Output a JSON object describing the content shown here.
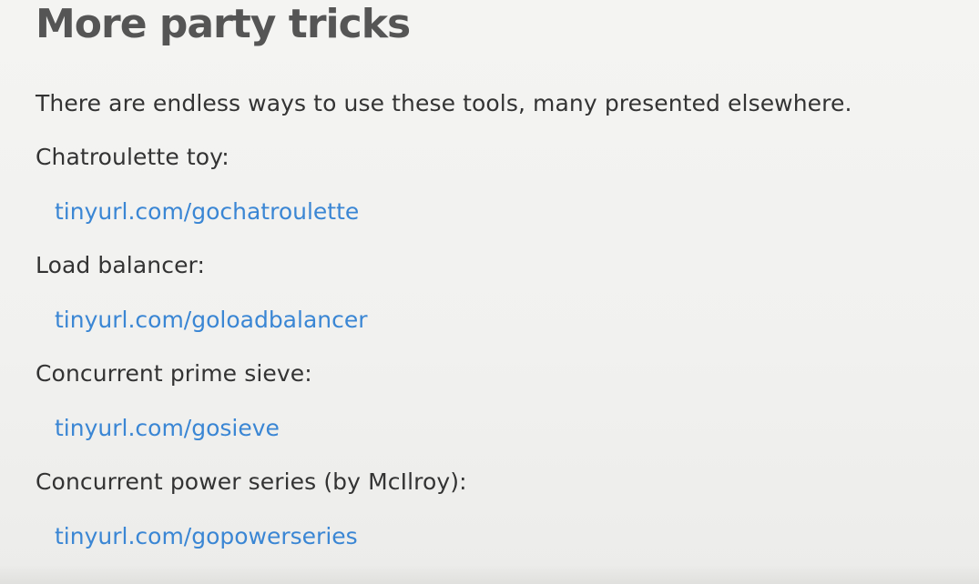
{
  "slide": {
    "title": "More party tricks",
    "intro": "There are endless ways to use these tools, many presented elsewhere.",
    "items": [
      {
        "label": "Chatroulette toy:",
        "link": "tinyurl.com/gochatroulette"
      },
      {
        "label": "Load balancer:",
        "link": "tinyurl.com/goloadbalancer"
      },
      {
        "label": "Concurrent prime sieve:",
        "link": "tinyurl.com/gosieve"
      },
      {
        "label": "Concurrent power series (by McIlroy):",
        "link": "tinyurl.com/gopowerseries"
      }
    ]
  },
  "colors": {
    "background": "#f2f2f0",
    "title": "#555555",
    "text": "#333333",
    "link": "#3a86d4"
  }
}
